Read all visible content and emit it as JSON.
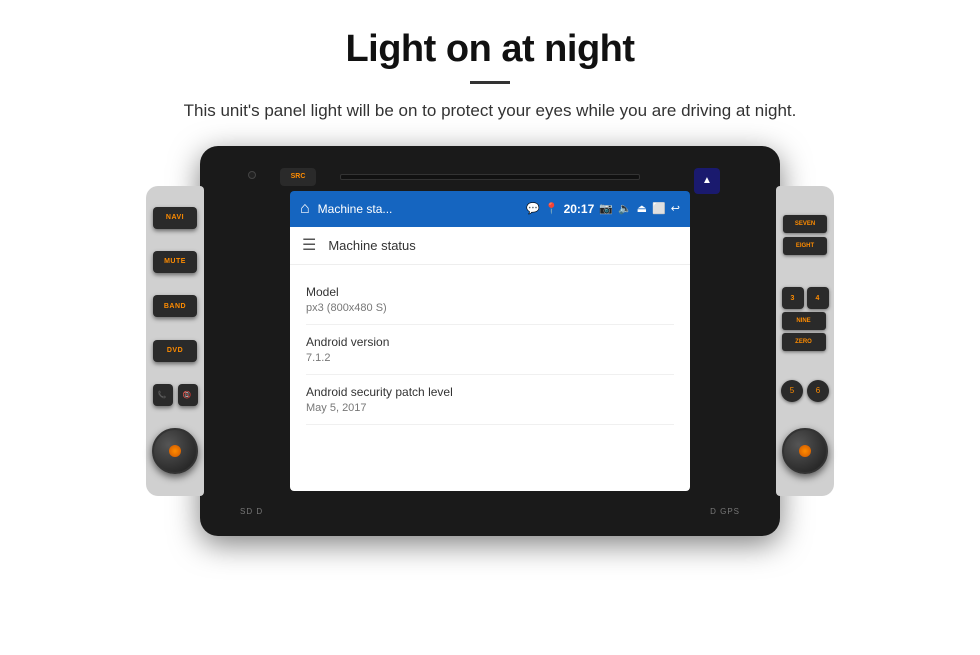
{
  "header": {
    "title": "Light on at night",
    "subtitle": "This unit's panel light will be on to protect your eyes while you are driving at night."
  },
  "device": {
    "status_bar": {
      "app_name": "Machine sta...",
      "time": "20:17"
    },
    "toolbar": {
      "title": "Machine status"
    },
    "info_rows": [
      {
        "label": "Model",
        "value": "px3 (800x480 S)"
      },
      {
        "label": "Android version",
        "value": "7.1.2"
      },
      {
        "label": "Android security patch level",
        "value": "May 5, 2017"
      }
    ],
    "buttons": {
      "src": "SRC",
      "navi": "NAVI",
      "mute": "MUTE",
      "band": "BAND",
      "dvd": "DVD",
      "seven": "SEVEN",
      "eight": "EIGHT",
      "three": "3",
      "four": "4",
      "nine": "NINE",
      "zero": "ZERO",
      "five": "5",
      "six": "6"
    },
    "bottom_labels": {
      "left": "SD  D",
      "right": "D  GPS"
    }
  }
}
